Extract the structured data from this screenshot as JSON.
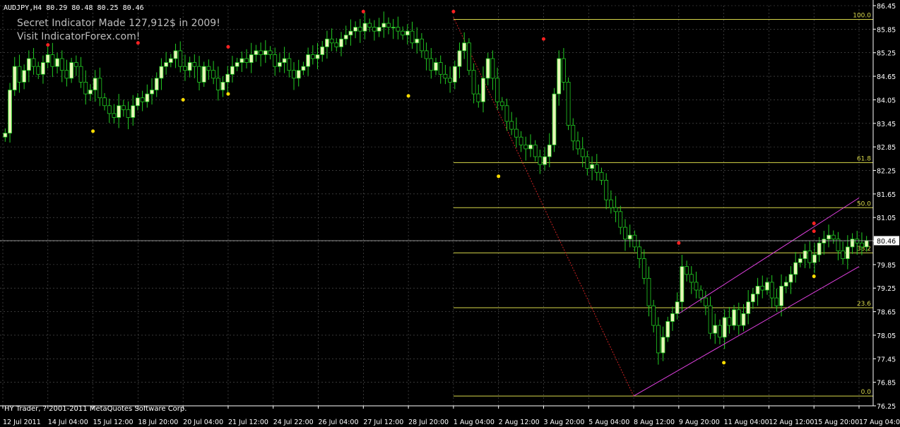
{
  "header": {
    "symbol_info": "AUDJPY,H4  80.29 80.48 80.25 80.46",
    "promo_line1": "Secret Indicator Made 127,912$ in 2009!",
    "promo_line2": "Visit IndicatorForex.com!"
  },
  "footer": {
    "copyright": "HY Trader, ? 2001-2011 MetaQuotes Software Corp."
  },
  "price_label": "80.46",
  "colors": {
    "background": "#000000",
    "grid": "#5a5a5a",
    "bull_candle": "#e8f5b8",
    "bear_candle": "#000000",
    "wick": "#22cc22",
    "fib": "#d8d84a",
    "channel": "#e040e0",
    "fractal_up": "#ff2222",
    "fractal_down": "#ffdd00",
    "zigzag": "#cc2222",
    "axis_text": "#ffffff"
  },
  "chart_data": {
    "type": "candlestick",
    "symbol": "AUDJPY",
    "timeframe": "H4",
    "ylim": [
      76.25,
      86.45
    ],
    "grid": true,
    "y_ticks": [
      "86.45",
      "85.85",
      "85.25",
      "84.65",
      "84.05",
      "83.45",
      "82.85",
      "82.25",
      "81.65",
      "81.05",
      "80.45",
      "79.85",
      "79.25",
      "78.65",
      "78.05",
      "77.45",
      "76.85",
      "76.25"
    ],
    "x_ticks": [
      "12 Jul 2011",
      "14 Jul 04:00",
      "15 Jul 12:00",
      "18 Jul 20:00",
      "20 Jul 04:00",
      "21 Jul 12:00",
      "24 Jul 22:00",
      "26 Jul 04:00",
      "27 Jul 12:00",
      "28 Jul 20:00",
      "1 Aug 04:00",
      "2 Aug 12:00",
      "3 Aug 20:00",
      "5 Aug 04:00",
      "8 Aug 12:00",
      "9 Aug 20:00",
      "11 Aug 04:00",
      "12 Aug 12:00",
      "15 Aug 20:00",
      "17 Aug 04:00"
    ],
    "last_price": 80.46,
    "closes": [
      83.2,
      84.3,
      84.9,
      84.5,
      84.8,
      85.1,
      84.9,
      84.7,
      85.0,
      85.2,
      84.9,
      85.1,
      84.8,
      84.6,
      85.0,
      84.9,
      84.5,
      84.2,
      84.3,
      84.6,
      84.1,
      83.9,
      83.7,
      83.6,
      83.9,
      83.8,
      83.6,
      83.9,
      84.1,
      84.0,
      84.2,
      84.3,
      84.6,
      84.9,
      85.0,
      85.1,
      85.3,
      84.9,
      84.8,
      85.0,
      84.9,
      84.5,
      84.9,
      84.8,
      84.6,
      84.3,
      84.5,
      84.7,
      84.9,
      85.0,
      85.1,
      85.0,
      85.2,
      85.3,
      85.2,
      85.3,
      85.2,
      84.9,
      85.0,
      85.1,
      84.8,
      84.6,
      84.8,
      84.9,
      85.2,
      85.1,
      85.2,
      85.4,
      85.6,
      85.5,
      85.4,
      85.6,
      85.7,
      85.8,
      85.9,
      85.8,
      86.0,
      85.9,
      85.8,
      85.9,
      86.0,
      85.9,
      85.9,
      85.8,
      85.7,
      85.8,
      85.5,
      85.6,
      85.3,
      85.1,
      84.8,
      85.0,
      84.7,
      84.6,
      84.5,
      84.9,
      85.3,
      85.5,
      84.8,
      84.2,
      84.0,
      84.6,
      85.1,
      84.6,
      84.0,
      83.9,
      83.5,
      83.3,
      83.1,
      82.9,
      82.8,
      82.9,
      82.6,
      82.4,
      82.6,
      82.9,
      84.2,
      85.1,
      84.5,
      83.4,
      83.0,
      82.8,
      82.6,
      82.3,
      82.4,
      82.2,
      82.0,
      81.5,
      81.3,
      81.2,
      80.8,
      80.5,
      80.6,
      80.3,
      80.0,
      79.5,
      78.8,
      78.3,
      77.6,
      78.0,
      78.4,
      78.6,
      78.9,
      79.8,
      79.6,
      79.4,
      79.2,
      79.0,
      78.8,
      78.1,
      78.3,
      78.0,
      78.5,
      78.3,
      78.7,
      78.3,
      78.6,
      78.9,
      79.1,
      79.3,
      79.2,
      79.4,
      79.0,
      78.8,
      79.3,
      79.4,
      79.6,
      79.9,
      80.0,
      80.2,
      79.9,
      80.1,
      80.4,
      80.5,
      80.6,
      80.5,
      80.2,
      80.0,
      80.3,
      80.5,
      80.4,
      80.3,
      80.46
    ],
    "fibonacci": {
      "levels": [
        {
          "label": "100.0",
          "price": 86.1
        },
        {
          "label": "61.8",
          "price": 82.45
        },
        {
          "label": "50.0",
          "price": 81.3
        },
        {
          "label": "38.2",
          "price": 80.15
        },
        {
          "label": "23.6",
          "price": 78.75
        },
        {
          "label": "0.0",
          "price": 76.5
        }
      ],
      "start_date": "1 Aug 04:00"
    },
    "channel": {
      "upper": {
        "from_x": "9 Aug 20:00",
        "from_y": 78.6,
        "to_x": "17 Aug 04:00",
        "to_y": 81.55
      },
      "lower": {
        "from_x": "8 Aug 12:00",
        "from_y": 76.5,
        "to_x": "17 Aug 04:00",
        "to_y": 79.8
      }
    },
    "zigzag": [
      {
        "x": "1 Aug 04:00",
        "y": 86.15
      },
      {
        "x": "8 Aug 12:00",
        "y": 76.5
      }
    ],
    "fractals_up": [
      {
        "x": "14 Jul 04:00",
        "y": 85.45
      },
      {
        "x": "18 Jul 20:00",
        "y": 85.5
      },
      {
        "x": "21 Jul 12:00",
        "y": 85.4
      },
      {
        "x": "27 Jul 12:00",
        "y": 86.3
      },
      {
        "x": "1 Aug 04:00",
        "y": 86.3
      },
      {
        "x": "3 Aug 20:00",
        "y": 85.6
      },
      {
        "x": "9 Aug 20:00",
        "y": 80.4
      },
      {
        "x": "15 Aug 20:00",
        "y": 80.9
      },
      {
        "x": "15 Aug 20:00",
        "y": 80.7
      }
    ],
    "fractals_down": [
      {
        "x": "15 Jul 12:00",
        "y": 83.25
      },
      {
        "x": "20 Jul 04:00",
        "y": 84.05
      },
      {
        "x": "21 Jul 12:00",
        "y": 84.2
      },
      {
        "x": "28 Jul 20:00",
        "y": 84.15
      },
      {
        "x": "2 Aug 12:00",
        "y": 82.1
      },
      {
        "x": "11 Aug 04:00",
        "y": 77.35
      },
      {
        "x": "15 Aug 20:00",
        "y": 79.55
      }
    ]
  }
}
